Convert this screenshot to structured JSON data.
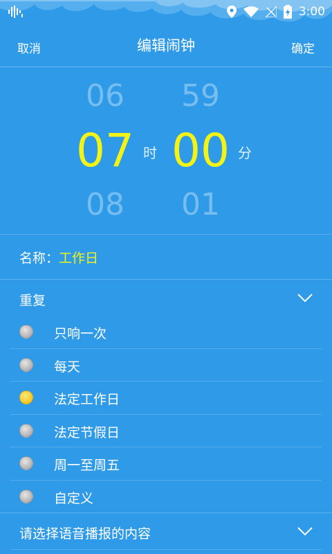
{
  "status_bar": {
    "time": "3:00"
  },
  "header": {
    "cancel_label": "取消",
    "title": "编辑闹钟",
    "confirm_label": "确定"
  },
  "picker": {
    "hour": {
      "prev": "06",
      "selected": "07",
      "next": "08",
      "unit": "时"
    },
    "minute": {
      "prev": "59",
      "selected": "00",
      "next": "01",
      "unit": "分"
    }
  },
  "name": {
    "label": "名称：",
    "value": "工作日"
  },
  "repeat": {
    "title": "重复",
    "selected_index": 2,
    "options": [
      "只响一次",
      "每天",
      "法定工作日",
      "法定节假日",
      "周一至周五",
      "自定义"
    ]
  },
  "voice": {
    "title": "请选择语音播报的内容"
  },
  "colors": {
    "background": "#2f9be8",
    "accent": "#f3f316",
    "radio_selected": "#f0b800"
  }
}
